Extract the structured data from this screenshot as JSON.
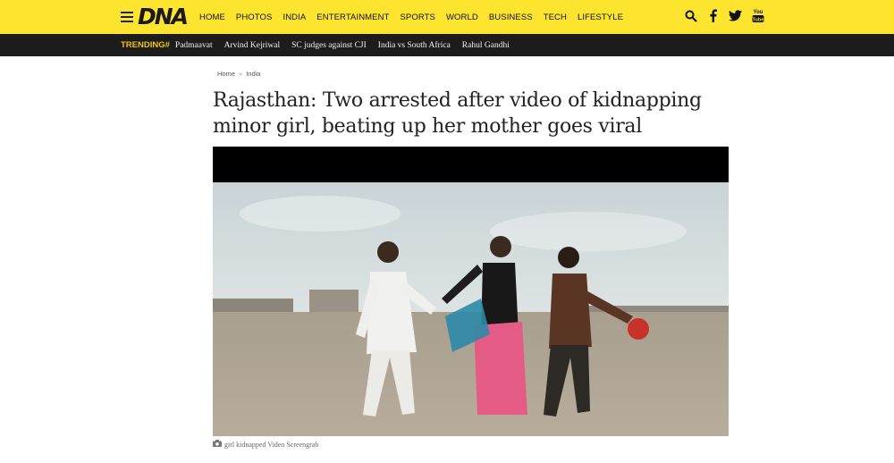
{
  "site": {
    "logo": "DNA",
    "nav": [
      "HOME",
      "PHOTOS",
      "INDIA",
      "ENTERTAINMENT",
      "SPORTS",
      "WORLD",
      "BUSINESS",
      "TECH",
      "LIFESTYLE"
    ],
    "social_icons": [
      "search-icon",
      "facebook-icon",
      "twitter-icon",
      "youtube-icon"
    ],
    "youtube_text": "You\nTube"
  },
  "trending": {
    "label": "TRENDING#",
    "items": [
      "Padmaavat",
      "Arvind Kejriwal",
      "SC judges against CJI",
      "India vs South Africa",
      "Rahul Gandhi"
    ]
  },
  "breadcrumb": {
    "home": "Home",
    "separator": "»",
    "section": "India"
  },
  "article": {
    "headline": "Rajasthan: Two arrested after video of kidnapping minor girl, beating up her mother goes viral",
    "caption": "girl kidnapped Video Screengrab"
  },
  "colors": {
    "topbar": "#fde42f",
    "trending_bg": "#1c1c1c",
    "trending_label": "#f5c400"
  }
}
